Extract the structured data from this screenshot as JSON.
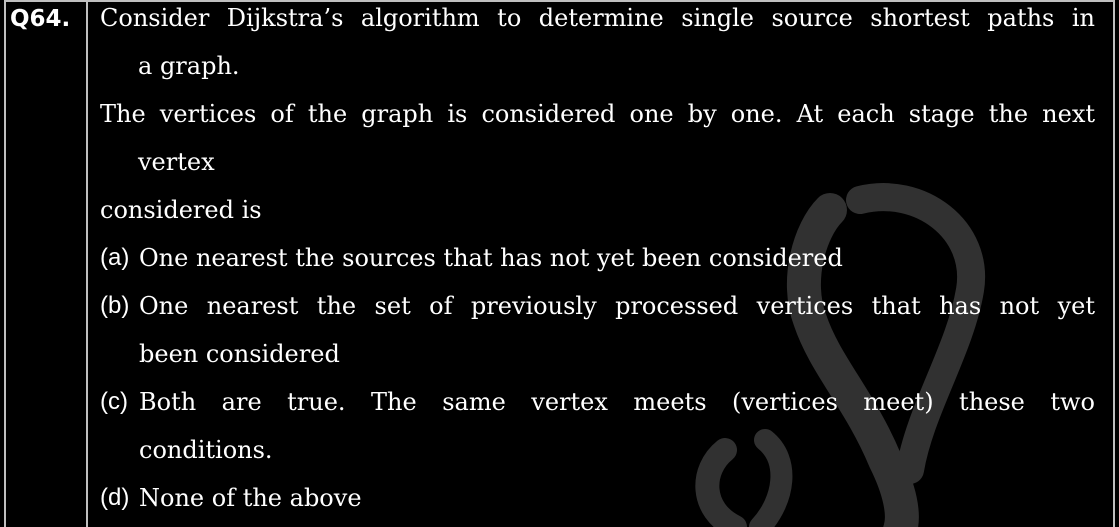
{
  "question": {
    "number": "Q64.",
    "stem_line1": "Consider Dijkstra’s algorithm to determine single source shortest paths in",
    "stem_line2": "a graph.",
    "stem_line3": "The vertices of the graph is considered one by one. At each stage the next",
    "stem_line4": "vertex",
    "stem_line5": "considered is"
  },
  "options": [
    {
      "label": "(a)",
      "line1": "One nearest the sources that has not yet been considered",
      "line2": ""
    },
    {
      "label": "(b)",
      "line1": "One nearest the set of previously processed vertices that has not yet",
      "line2": "been considered"
    },
    {
      "label": "(c)",
      "line1": "Both are true. The same vertex meets (vertices meet) these two",
      "line2": "conditions."
    },
    {
      "label": "(d)",
      "line1": "None of the above",
      "line2": ""
    }
  ],
  "colors": {
    "background": "#000000",
    "text": "#ffffff",
    "border": "#bfbfbf",
    "watermark": "#5a5a5a"
  }
}
